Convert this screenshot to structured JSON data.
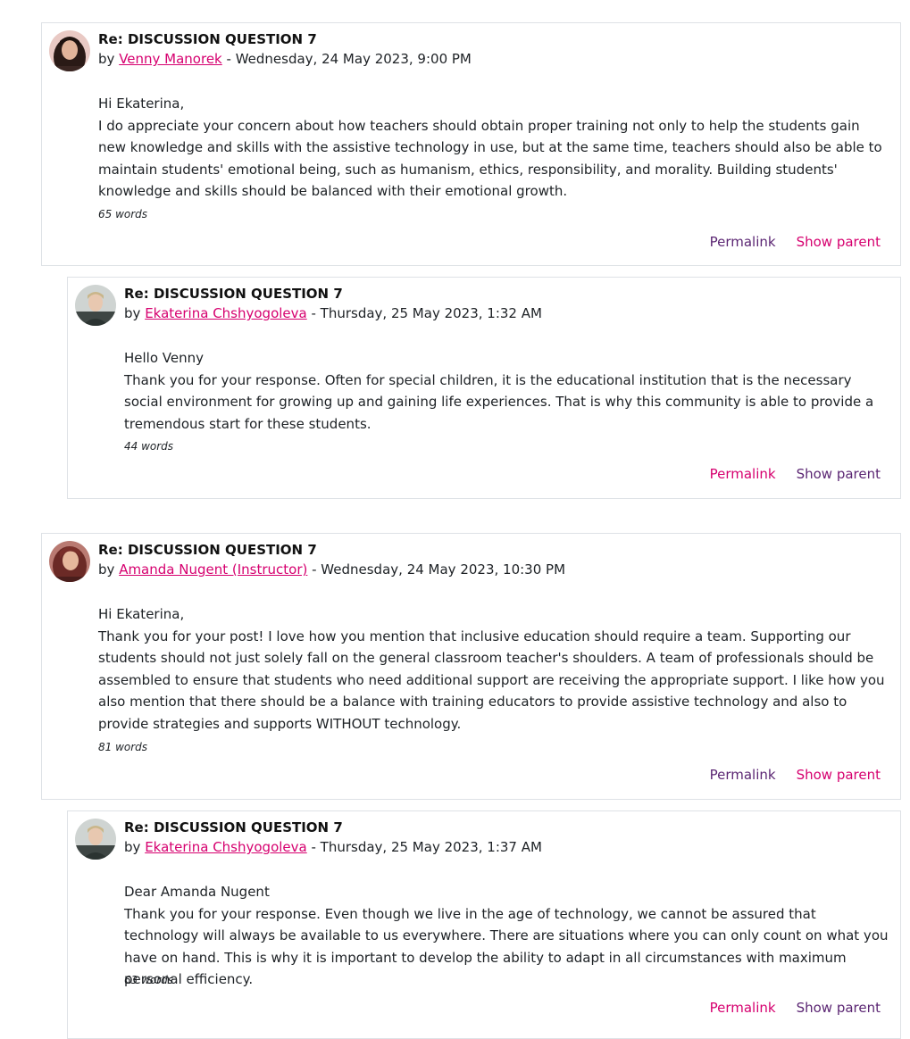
{
  "posts": [
    {
      "subject": "Re: DISCUSSION QUESTION 7",
      "by": "by",
      "author": "Venny Manorek",
      "date": " - Wednesday, 24 May 2023, 9:00 PM",
      "greeting": "Hi Ekaterina,",
      "body": "I do appreciate your concern about how teachers should obtain proper training not only to help the students gain new knowledge and skills with the assistive technology in use, but at the same time, teachers should also be able to maintain students' emotional being, such as humanism, ethics, responsibility, and morality. Building students' knowledge and skills should be balanced with their emotional growth.",
      "word_count": "65 words",
      "permalink": "Permalink",
      "show_parent": "Show parent"
    },
    {
      "subject": "Re: DISCUSSION QUESTION 7",
      "by": "by",
      "author": "Ekaterina Chshyogoleva",
      "date": " - Thursday, 25 May 2023, 1:32 AM",
      "greeting": "Hello Venny",
      "body": "Thank you for your response. Often for special children, it is the educational institution that is the necessary social environment for growing up and gaining life experiences. That is why this community is able to provide a tremendous start for these students.",
      "word_count": "44 words",
      "permalink": "Permalink",
      "show_parent": "Show parent"
    },
    {
      "subject": "Re: DISCUSSION QUESTION 7",
      "by": "by",
      "author": "Amanda Nugent (Instructor)",
      "date": " - Wednesday, 24 May 2023, 10:30 PM",
      "greeting": "Hi Ekaterina,",
      "body": "Thank you for your post! I love how you mention that inclusive education should require a team. Supporting our students should not just solely fall on the general classroom teacher's shoulders. A team of professionals should be assembled to ensure that students who need additional support are receiving the appropriate support. I like how you also mention that there should be a balance with training educators to provide assistive technology and also to provide strategies and supports WITHOUT technology.",
      "word_count": "81 words",
      "permalink": "Permalink",
      "show_parent": "Show parent"
    },
    {
      "subject": "Re: DISCUSSION QUESTION 7",
      "by": "by",
      "author": "Ekaterina Chshyogoleva",
      "date": " - Thursday, 25 May 2023, 1:37 AM",
      "greeting": "Dear Amanda Nugent",
      "body": "Thank you for your response. Even though we live in the age of technology, we cannot be assured that technology will always be available to us everywhere. There are situations where you can only count on what you have on hand. This is why it is important to develop the ability to adapt in all circumstances with maximum personal efficiency.",
      "word_count": "63 words",
      "permalink": "Permalink",
      "show_parent": "Show parent"
    }
  ],
  "colors": {
    "link": "#d6006f",
    "visited_link": "#5b2673",
    "border": "#dee2e6"
  }
}
